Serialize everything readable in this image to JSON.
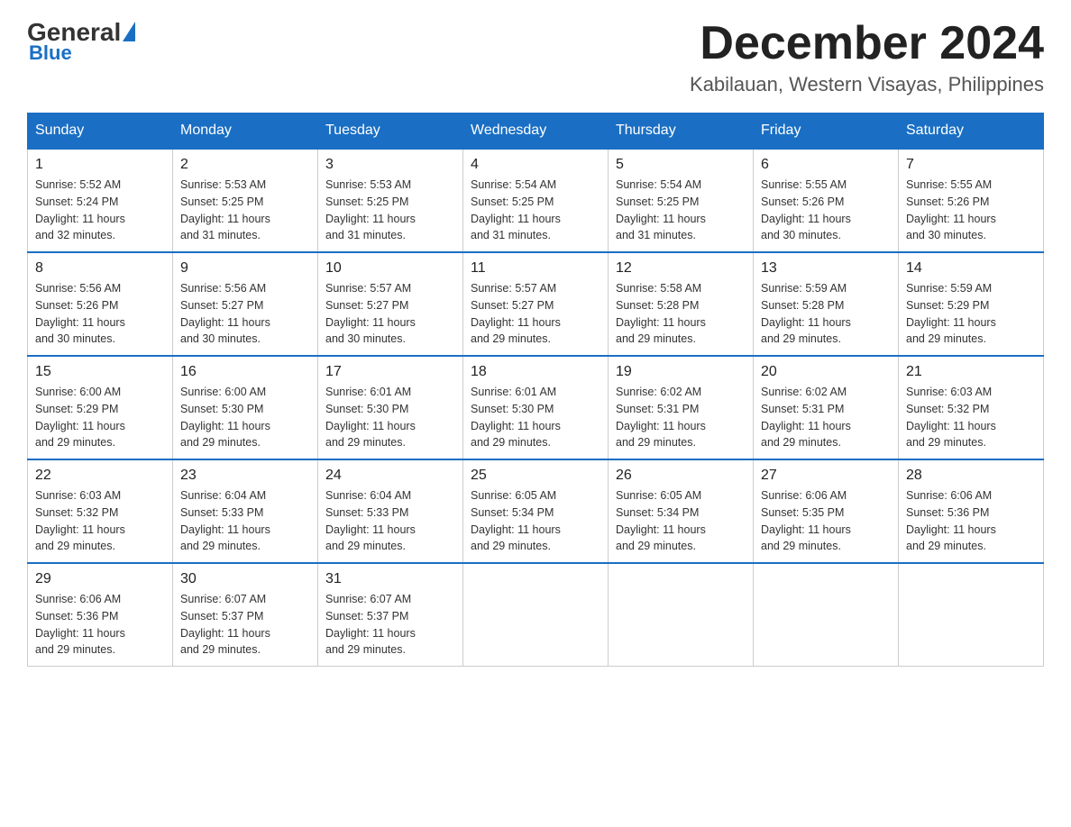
{
  "header": {
    "logo_general": "General",
    "logo_blue": "Blue",
    "month_title": "December 2024",
    "location": "Kabilauan, Western Visayas, Philippines"
  },
  "weekdays": [
    "Sunday",
    "Monday",
    "Tuesday",
    "Wednesday",
    "Thursday",
    "Friday",
    "Saturday"
  ],
  "weeks": [
    [
      {
        "day": "1",
        "sunrise": "5:52 AM",
        "sunset": "5:24 PM",
        "daylight": "11 hours and 32 minutes."
      },
      {
        "day": "2",
        "sunrise": "5:53 AM",
        "sunset": "5:25 PM",
        "daylight": "11 hours and 31 minutes."
      },
      {
        "day": "3",
        "sunrise": "5:53 AM",
        "sunset": "5:25 PM",
        "daylight": "11 hours and 31 minutes."
      },
      {
        "day": "4",
        "sunrise": "5:54 AM",
        "sunset": "5:25 PM",
        "daylight": "11 hours and 31 minutes."
      },
      {
        "day": "5",
        "sunrise": "5:54 AM",
        "sunset": "5:25 PM",
        "daylight": "11 hours and 31 minutes."
      },
      {
        "day": "6",
        "sunrise": "5:55 AM",
        "sunset": "5:26 PM",
        "daylight": "11 hours and 30 minutes."
      },
      {
        "day": "7",
        "sunrise": "5:55 AM",
        "sunset": "5:26 PM",
        "daylight": "11 hours and 30 minutes."
      }
    ],
    [
      {
        "day": "8",
        "sunrise": "5:56 AM",
        "sunset": "5:26 PM",
        "daylight": "11 hours and 30 minutes."
      },
      {
        "day": "9",
        "sunrise": "5:56 AM",
        "sunset": "5:27 PM",
        "daylight": "11 hours and 30 minutes."
      },
      {
        "day": "10",
        "sunrise": "5:57 AM",
        "sunset": "5:27 PM",
        "daylight": "11 hours and 30 minutes."
      },
      {
        "day": "11",
        "sunrise": "5:57 AM",
        "sunset": "5:27 PM",
        "daylight": "11 hours and 29 minutes."
      },
      {
        "day": "12",
        "sunrise": "5:58 AM",
        "sunset": "5:28 PM",
        "daylight": "11 hours and 29 minutes."
      },
      {
        "day": "13",
        "sunrise": "5:59 AM",
        "sunset": "5:28 PM",
        "daylight": "11 hours and 29 minutes."
      },
      {
        "day": "14",
        "sunrise": "5:59 AM",
        "sunset": "5:29 PM",
        "daylight": "11 hours and 29 minutes."
      }
    ],
    [
      {
        "day": "15",
        "sunrise": "6:00 AM",
        "sunset": "5:29 PM",
        "daylight": "11 hours and 29 minutes."
      },
      {
        "day": "16",
        "sunrise": "6:00 AM",
        "sunset": "5:30 PM",
        "daylight": "11 hours and 29 minutes."
      },
      {
        "day": "17",
        "sunrise": "6:01 AM",
        "sunset": "5:30 PM",
        "daylight": "11 hours and 29 minutes."
      },
      {
        "day": "18",
        "sunrise": "6:01 AM",
        "sunset": "5:30 PM",
        "daylight": "11 hours and 29 minutes."
      },
      {
        "day": "19",
        "sunrise": "6:02 AM",
        "sunset": "5:31 PM",
        "daylight": "11 hours and 29 minutes."
      },
      {
        "day": "20",
        "sunrise": "6:02 AM",
        "sunset": "5:31 PM",
        "daylight": "11 hours and 29 minutes."
      },
      {
        "day": "21",
        "sunrise": "6:03 AM",
        "sunset": "5:32 PM",
        "daylight": "11 hours and 29 minutes."
      }
    ],
    [
      {
        "day": "22",
        "sunrise": "6:03 AM",
        "sunset": "5:32 PM",
        "daylight": "11 hours and 29 minutes."
      },
      {
        "day": "23",
        "sunrise": "6:04 AM",
        "sunset": "5:33 PM",
        "daylight": "11 hours and 29 minutes."
      },
      {
        "day": "24",
        "sunrise": "6:04 AM",
        "sunset": "5:33 PM",
        "daylight": "11 hours and 29 minutes."
      },
      {
        "day": "25",
        "sunrise": "6:05 AM",
        "sunset": "5:34 PM",
        "daylight": "11 hours and 29 minutes."
      },
      {
        "day": "26",
        "sunrise": "6:05 AM",
        "sunset": "5:34 PM",
        "daylight": "11 hours and 29 minutes."
      },
      {
        "day": "27",
        "sunrise": "6:06 AM",
        "sunset": "5:35 PM",
        "daylight": "11 hours and 29 minutes."
      },
      {
        "day": "28",
        "sunrise": "6:06 AM",
        "sunset": "5:36 PM",
        "daylight": "11 hours and 29 minutes."
      }
    ],
    [
      {
        "day": "29",
        "sunrise": "6:06 AM",
        "sunset": "5:36 PM",
        "daylight": "11 hours and 29 minutes."
      },
      {
        "day": "30",
        "sunrise": "6:07 AM",
        "sunset": "5:37 PM",
        "daylight": "11 hours and 29 minutes."
      },
      {
        "day": "31",
        "sunrise": "6:07 AM",
        "sunset": "5:37 PM",
        "daylight": "11 hours and 29 minutes."
      },
      null,
      null,
      null,
      null
    ]
  ],
  "labels": {
    "sunrise_prefix": "Sunrise: ",
    "sunset_prefix": "Sunset: ",
    "daylight_prefix": "Daylight: "
  }
}
